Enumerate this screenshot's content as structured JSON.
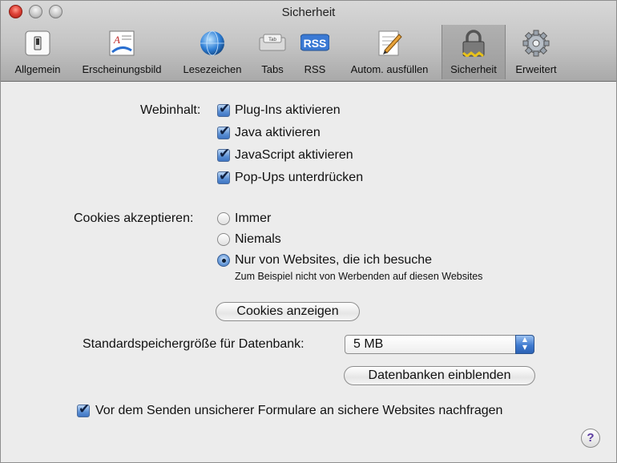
{
  "window": {
    "title": "Sicherheit"
  },
  "toolbar": {
    "items": [
      {
        "label": "Allgemein",
        "icon": "general-switch-icon"
      },
      {
        "label": "Erscheinungsbild",
        "icon": "appearance-icon"
      },
      {
        "label": "Lesezeichen",
        "icon": "bookmarks-globe-icon"
      },
      {
        "label": "Tabs",
        "icon": "tabs-icon"
      },
      {
        "label": "RSS",
        "icon": "rss-icon",
        "badge": "RSS"
      },
      {
        "label": "Autom. ausfüllen",
        "icon": "autofill-pencil-icon"
      },
      {
        "label": "Sicherheit",
        "icon": "padlock-icon",
        "selected": true
      },
      {
        "label": "Erweitert",
        "icon": "gear-icon"
      }
    ],
    "tabs_badge": "Tab"
  },
  "web_content": {
    "label": "Webinhalt:",
    "options": [
      {
        "label": "Plug-Ins aktivieren",
        "checked": true
      },
      {
        "label": "Java aktivieren",
        "checked": true
      },
      {
        "label": "JavaScript aktivieren",
        "checked": true
      },
      {
        "label": "Pop-Ups unterdrücken",
        "checked": true
      }
    ]
  },
  "cookies": {
    "label": "Cookies akzeptieren:",
    "options": [
      {
        "label": "Immer",
        "selected": false
      },
      {
        "label": "Niemals",
        "selected": false
      },
      {
        "label": "Nur von Websites, die ich besuche",
        "selected": true
      }
    ],
    "note": "Zum Beispiel nicht von Werbenden auf diesen Websites",
    "show_button": "Cookies anzeigen"
  },
  "database": {
    "label": "Standardspeichergröße für Datenbank:",
    "value": "5 MB",
    "show_button": "Datenbanken einblenden"
  },
  "insecure_forms": {
    "label": "Vor dem Senden unsicherer Formulare an sichere Websites nachfragen",
    "checked": true
  },
  "help": {
    "symbol": "?"
  },
  "colors": {
    "accent": "#3f75c2",
    "toolbar_selected": "#a6a6a6"
  }
}
